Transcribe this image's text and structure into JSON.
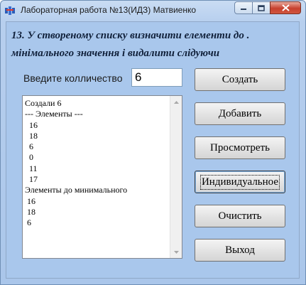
{
  "window": {
    "title": "Лабораторная работа №13(ИДЗ) Матвиенко",
    "app_icon": "delphi-app-icon",
    "controls": [
      "minimize-icon",
      "maximize-icon",
      "close-icon"
    ]
  },
  "task": {
    "line1": "13. У створеному списку визначити елементи до .",
    "line2": "мінімального значення і видалити слідуючи"
  },
  "form": {
    "qty_label": "Введите колличество",
    "qty_value": "6"
  },
  "listbox": {
    "lines": [
      "Создали 6",
      "--- Элементы ---",
      "  16",
      "  18",
      "  6",
      "  0",
      "  11",
      "  17",
      "Элементы до минимального",
      " 16",
      " 18",
      " 6"
    ]
  },
  "buttons": {
    "create": "Создать",
    "add": "Добавить",
    "view": "Просмотреть",
    "individual": "Индивидуальное",
    "clear": "Очистить",
    "exit": "Выход"
  }
}
